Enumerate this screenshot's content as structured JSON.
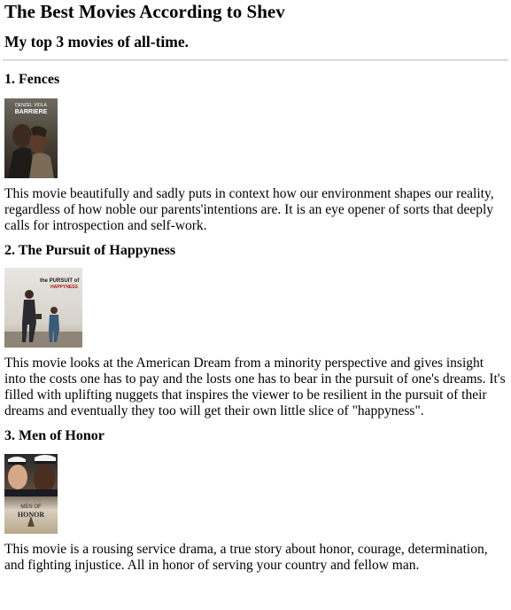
{
  "page": {
    "title": "The Best Movies According to Shev",
    "subtitle": "My top 3 movies of all-time."
  },
  "movies": [
    {
      "title": "1. Fences",
      "poster": {
        "name": "fences-poster",
        "credit": "DENZEL  VIOLA",
        "credit_2": "BARRIERE"
      },
      "description": "This movie beautifully and sadly puts in context how our environment shapes our reality, regardless of how noble our parents'intentions are. It is an eye opener of sorts that deeply calls for introspection and self-work."
    },
    {
      "title": "2. The Pursuit of Happyness",
      "poster": {
        "name": "pursuit-of-happyness-poster",
        "line1": "the PURSUIT of",
        "line2": "HAPPYNESS"
      },
      "description": "This movie looks at the American Dream from a minority perspective and gives insight into the costs one has to pay and the losts one has to bear in the pursuit of one's dreams. It's filled with uplifting nuggets that inspires the viewer to be resilient in the pursuit of their dreams and eventually they too will get their own little slice of \"happyness\"."
    },
    {
      "title": "3. Men of Honor",
      "poster": {
        "name": "men-of-honor-poster",
        "line1": "MEN OF",
        "line2": "HONOR"
      },
      "description": "This movie is a rousing service drama, a true story about honor, courage, determination, and fighting injustice. All in honor of serving your country and fellow man."
    }
  ]
}
